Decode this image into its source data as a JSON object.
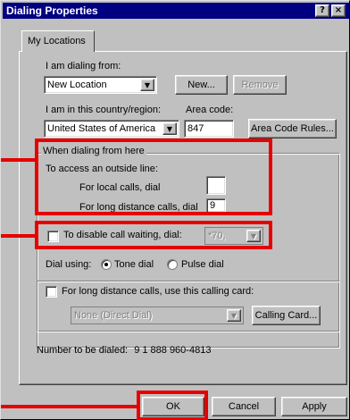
{
  "window": {
    "title": "Dialing Properties",
    "help_glyph": "?",
    "close_glyph": "×"
  },
  "tabs": [
    {
      "label": "My Locations"
    }
  ],
  "location": {
    "label": "I am dialing from:",
    "value": "New Location",
    "new_button": "New...",
    "remove_button": "Remove"
  },
  "country": {
    "label": "I am in this country/region:",
    "value": "United States of America"
  },
  "area_code": {
    "label": "Area code:",
    "value": "847",
    "rules_button": "Area Code Rules..."
  },
  "dialing_group": {
    "title": "When dialing from here",
    "outside_line_label": "To access an outside line:",
    "local_label": "For local calls, dial",
    "local_value": "",
    "long_distance_label": "For long distance calls, dial",
    "long_distance_value": "9"
  },
  "call_waiting": {
    "label": "To disable call waiting, dial:",
    "checked": false,
    "value": "*70,"
  },
  "dial_using": {
    "label": "Dial using:",
    "options": [
      {
        "label": "Tone dial",
        "selected": true
      },
      {
        "label": "Pulse dial",
        "selected": false
      }
    ]
  },
  "calling_card": {
    "checkbox_label": "For long distance calls, use this calling card:",
    "checked": false,
    "value": "None (Direct Dial)",
    "button": "Calling Card..."
  },
  "number_preview": {
    "label": "Number to be dialed:",
    "value": "9 1 888 960-4813"
  },
  "footer": {
    "ok": "OK",
    "cancel": "Cancel",
    "apply": "Apply"
  },
  "annotation_color": "#e60000",
  "icons": [
    "help-icon",
    "close-icon",
    "dropdown-arrow-icon"
  ]
}
